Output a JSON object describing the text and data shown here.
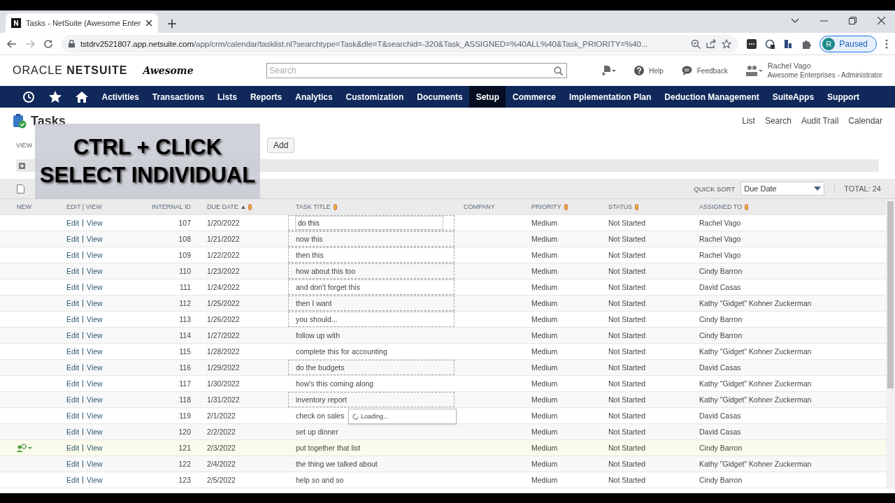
{
  "browser": {
    "tab_title": "Tasks - NetSuite (Awesome Enter",
    "url_host": "tstdrv2521807.app.netsuite.com",
    "url_path": "/app/crm/calendar/tasklist.nl?searchtype=Task&dle=T&searchid=-320&Task_ASSIGNED=%40ALL%40&Task_PRIORITY=%40...",
    "profile_initial": "R",
    "profile_status": "Paused"
  },
  "header": {
    "logo_oracle": "ORACLE",
    "logo_netsuite": "NETSUITE",
    "company_logo": "Awesome",
    "search": {
      "placeholder": "Search"
    },
    "help": "Help",
    "feedback": "Feedback",
    "user_name": "Rachel Vago",
    "user_role": "Awesome Enterprises - Administrator"
  },
  "nav": [
    {
      "label": "Activities",
      "selected": false
    },
    {
      "label": "Transactions",
      "selected": false
    },
    {
      "label": "Lists",
      "selected": false
    },
    {
      "label": "Reports",
      "selected": false
    },
    {
      "label": "Analytics",
      "selected": false
    },
    {
      "label": "Customization",
      "selected": false
    },
    {
      "label": "Documents",
      "selected": false
    },
    {
      "label": "Setup",
      "selected": true
    },
    {
      "label": "Commerce",
      "selected": false
    },
    {
      "label": "Implementation Plan",
      "selected": false
    },
    {
      "label": "Deduction Management",
      "selected": false
    },
    {
      "label": "SuiteApps",
      "selected": false
    },
    {
      "label": "Support",
      "selected": false
    }
  ],
  "page": {
    "title": "Tasks",
    "links": [
      "List",
      "Search",
      "Audit Trail",
      "Calendar"
    ],
    "view_label": "VIEW",
    "add_button": "Add",
    "quick_sort_label": "QUICK SORT",
    "quick_sort_value": "Due Date",
    "total": "TOTAL: 24"
  },
  "caption": [
    "CTRL + CLICK",
    "SELECT INDIVIDUAL"
  ],
  "table": {
    "columns": [
      "NEW",
      "EDIT | VIEW",
      "INTERNAL ID",
      "DUE DATE",
      "TASK TITLE",
      "COMPANY",
      "PRIORITY",
      "STATUS",
      "ASSIGNED TO"
    ],
    "rows": [
      {
        "edit": "Edit",
        "view": "View",
        "id": "107",
        "due": "1/20/2022",
        "title": "do this",
        "priority": "Medium",
        "status": "Not Started",
        "assigned": "Rachel Vago",
        "selected": true,
        "editing": true,
        "hovered": false
      },
      {
        "edit": "Edit",
        "view": "View",
        "id": "108",
        "due": "1/21/2022",
        "title": "now this",
        "priority": "Medium",
        "status": "Not Started",
        "assigned": "Rachel Vago",
        "selected": true,
        "editing": false,
        "hovered": false
      },
      {
        "edit": "Edit",
        "view": "View",
        "id": "109",
        "due": "1/22/2022",
        "title": "then this",
        "priority": "Medium",
        "status": "Not Started",
        "assigned": "Rachel Vago",
        "selected": true,
        "editing": false,
        "hovered": false
      },
      {
        "edit": "Edit",
        "view": "View",
        "id": "110",
        "due": "1/23/2022",
        "title": "how about this too",
        "priority": "Medium",
        "status": "Not Started",
        "assigned": "Cindy Barron",
        "selected": true,
        "editing": false,
        "hovered": false
      },
      {
        "edit": "Edit",
        "view": "View",
        "id": "111",
        "due": "1/24/2022",
        "title": "and don't forget this",
        "priority": "Medium",
        "status": "Not Started",
        "assigned": "David Casas",
        "selected": true,
        "editing": false,
        "hovered": false
      },
      {
        "edit": "Edit",
        "view": "View",
        "id": "112",
        "due": "1/25/2022",
        "title": "then I want",
        "priority": "Medium",
        "status": "Not Started",
        "assigned": "Kathy \"Gidget\" Kohner Zuckerman",
        "selected": true,
        "editing": false,
        "hovered": false
      },
      {
        "edit": "Edit",
        "view": "View",
        "id": "113",
        "due": "1/26/2022",
        "title": "you should...",
        "priority": "Medium",
        "status": "Not Started",
        "assigned": "Cindy Barron",
        "selected": true,
        "editing": false,
        "hovered": false
      },
      {
        "edit": "Edit",
        "view": "View",
        "id": "114",
        "due": "1/27/2022",
        "title": "follow up with",
        "priority": "Medium",
        "status": "Not Started",
        "assigned": "Cindy Barron",
        "selected": false,
        "editing": false,
        "hovered": false
      },
      {
        "edit": "Edit",
        "view": "View",
        "id": "115",
        "due": "1/28/2022",
        "title": "complete this for accounting",
        "priority": "Medium",
        "status": "Not Started",
        "assigned": "Kathy \"Gidget\" Kohner Zuckerman",
        "selected": false,
        "editing": false,
        "hovered": false
      },
      {
        "edit": "Edit",
        "view": "View",
        "id": "116",
        "due": "1/29/2022",
        "title": "do the budgets",
        "priority": "Medium",
        "status": "Not Started",
        "assigned": "David Casas",
        "selected": true,
        "editing": false,
        "hovered": false
      },
      {
        "edit": "Edit",
        "view": "View",
        "id": "117",
        "due": "1/30/2022",
        "title": "how's this coming along",
        "priority": "Medium",
        "status": "Not Started",
        "assigned": "Kathy \"Gidget\" Kohner Zuckerman",
        "selected": false,
        "editing": false,
        "hovered": false
      },
      {
        "edit": "Edit",
        "view": "View",
        "id": "118",
        "due": "1/31/2022",
        "title": "inventory report",
        "priority": "Medium",
        "status": "Not Started",
        "assigned": "Kathy \"Gidget\" Kohner Zuckerman",
        "selected": true,
        "editing": false,
        "hovered": false
      },
      {
        "edit": "Edit",
        "view": "View",
        "id": "119",
        "due": "2/1/2022",
        "title": "check on sales",
        "priority": "Medium",
        "status": "Not Started",
        "assigned": "David Casas",
        "selected": false,
        "editing": false,
        "hovered": false,
        "popup": "Loading..."
      },
      {
        "edit": "Edit",
        "view": "View",
        "id": "120",
        "due": "2/2/2022",
        "title": "set up dinner",
        "priority": "Medium",
        "status": "Not Started",
        "assigned": "David Casas",
        "selected": false,
        "editing": false,
        "hovered": false
      },
      {
        "edit": "Edit",
        "view": "View",
        "id": "121",
        "due": "2/3/2022",
        "title": "put together that list",
        "priority": "Medium",
        "status": "Not Started",
        "assigned": "Cindy Barron",
        "selected": false,
        "editing": false,
        "hovered": true
      },
      {
        "edit": "Edit",
        "view": "View",
        "id": "122",
        "due": "2/4/2022",
        "title": "the thing we talked about",
        "priority": "Medium",
        "status": "Not Started",
        "assigned": "Kathy \"Gidget\" Kohner Zuckerman",
        "selected": false,
        "editing": false,
        "hovered": false
      },
      {
        "edit": "Edit",
        "view": "View",
        "id": "123",
        "due": "2/5/2022",
        "title": "help so and so",
        "priority": "Medium",
        "status": "Not Started",
        "assigned": "Cindy Barron",
        "selected": false,
        "editing": false,
        "hovered": false
      }
    ]
  }
}
